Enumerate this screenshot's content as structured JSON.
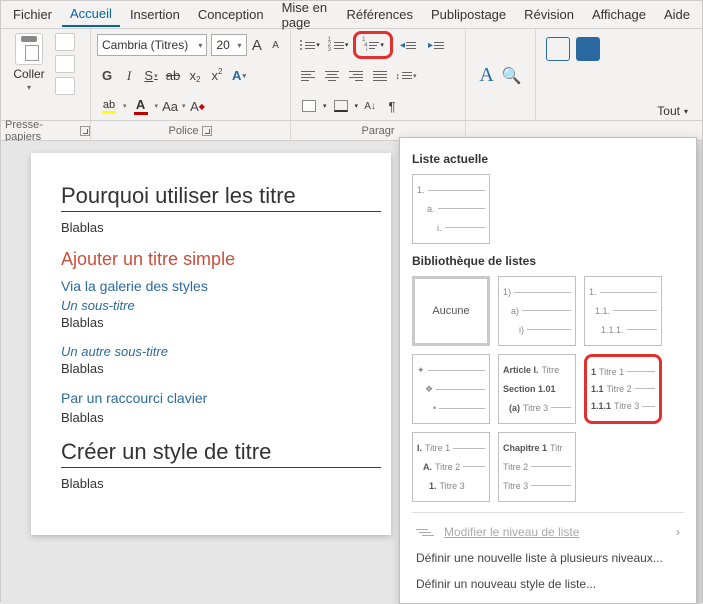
{
  "menu": {
    "tabs": [
      "Fichier",
      "Accueil",
      "Insertion",
      "Conception",
      "Mise en page",
      "Références",
      "Publipostage",
      "Révision",
      "Affichage",
      "Aide"
    ],
    "active": "Accueil"
  },
  "ribbon": {
    "clipboard": {
      "paste": "Coller",
      "label": "Presse-papiers"
    },
    "font": {
      "name": "Cambria (Titres)",
      "size": "20",
      "label": "Police",
      "bold": "G",
      "italic": "I",
      "underline": "S",
      "strike": "ab",
      "aa": "Aa",
      "clear": "A",
      "grow": "A",
      "shrink": "A"
    },
    "para": {
      "label": "Paragr"
    },
    "tout": "Tout"
  },
  "document": {
    "h1_a": "Pourquoi utiliser les titre",
    "body": "Blablas",
    "h2_a": "Ajouter un titre simple",
    "h3_a": "Via la galerie des styles",
    "h4_a": "Un sous-titre",
    "h4_b": "Un autre sous-titre",
    "h3_b": "Par un raccourci clavier",
    "h1_b": "Créer un style de titre"
  },
  "dropdown": {
    "current_heading": "Liste actuelle",
    "library_heading": "Bibliothèque de listes",
    "none": "Aucune",
    "current": {
      "l1": "1.",
      "l2": "a.",
      "l3": "i."
    },
    "lib": [
      {
        "l1": "1)",
        "l2": "a)",
        "l3": "i)"
      },
      {
        "l1": "1.",
        "l2": "1.1.",
        "l3": "1.1.1."
      },
      {
        "l1": "✦",
        "l2": "❖",
        "l3": "•"
      },
      {
        "l1": "Article I.",
        "t1": "Titre",
        "l2": "Section 1.01",
        "t2": "",
        "l3": "(a)",
        "t3": "Titre 3"
      },
      {
        "l1": "1",
        "t1": "Titre 1",
        "l2": "1.1",
        "t2": "Titre 2",
        "l3": "1.1.1",
        "t3": "Titre 3"
      },
      {
        "l1": "I.",
        "t1": "Titre 1",
        "l2": "A.",
        "t2": "Titre 2",
        "l3": "1.",
        "t3": "Titre 3"
      },
      {
        "l1": "Chapitre 1",
        "t1": "Titr",
        "l2": "",
        "t2": "Titre 2",
        "l3": "",
        "t3": "Titre 3"
      }
    ],
    "modify": "Modifier le niveau de liste",
    "define_multi": "Définir une nouvelle liste à plusieurs niveaux...",
    "define_style": "Définir un nouveau style de liste..."
  }
}
